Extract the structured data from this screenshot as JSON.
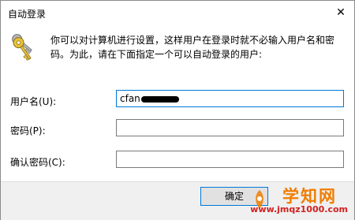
{
  "window": {
    "title": "自动登录",
    "close_glyph": "✕"
  },
  "content": {
    "icon": "keys-icon",
    "description": "你可以对计算机进行设置，这样用户在登录时就不必输入用户名和密码。为此，请在下面指定一个可以自动登录的用户:"
  },
  "fields": {
    "username": {
      "label": "用户名(U):",
      "value": "cfan"
    },
    "password": {
      "label": "密码(P):",
      "value": ""
    },
    "confirm": {
      "label": "确认密码(C):",
      "value": ""
    }
  },
  "footer": {
    "ok_label": "确定"
  },
  "watermark": {
    "brand": "学知网",
    "url": "www.jmqz1000.com"
  },
  "colors": {
    "focus_border": "#0078d7",
    "footer_bg": "#f0f0f0",
    "watermark_orange": "#f07c00",
    "watermark_red": "#d22020"
  }
}
